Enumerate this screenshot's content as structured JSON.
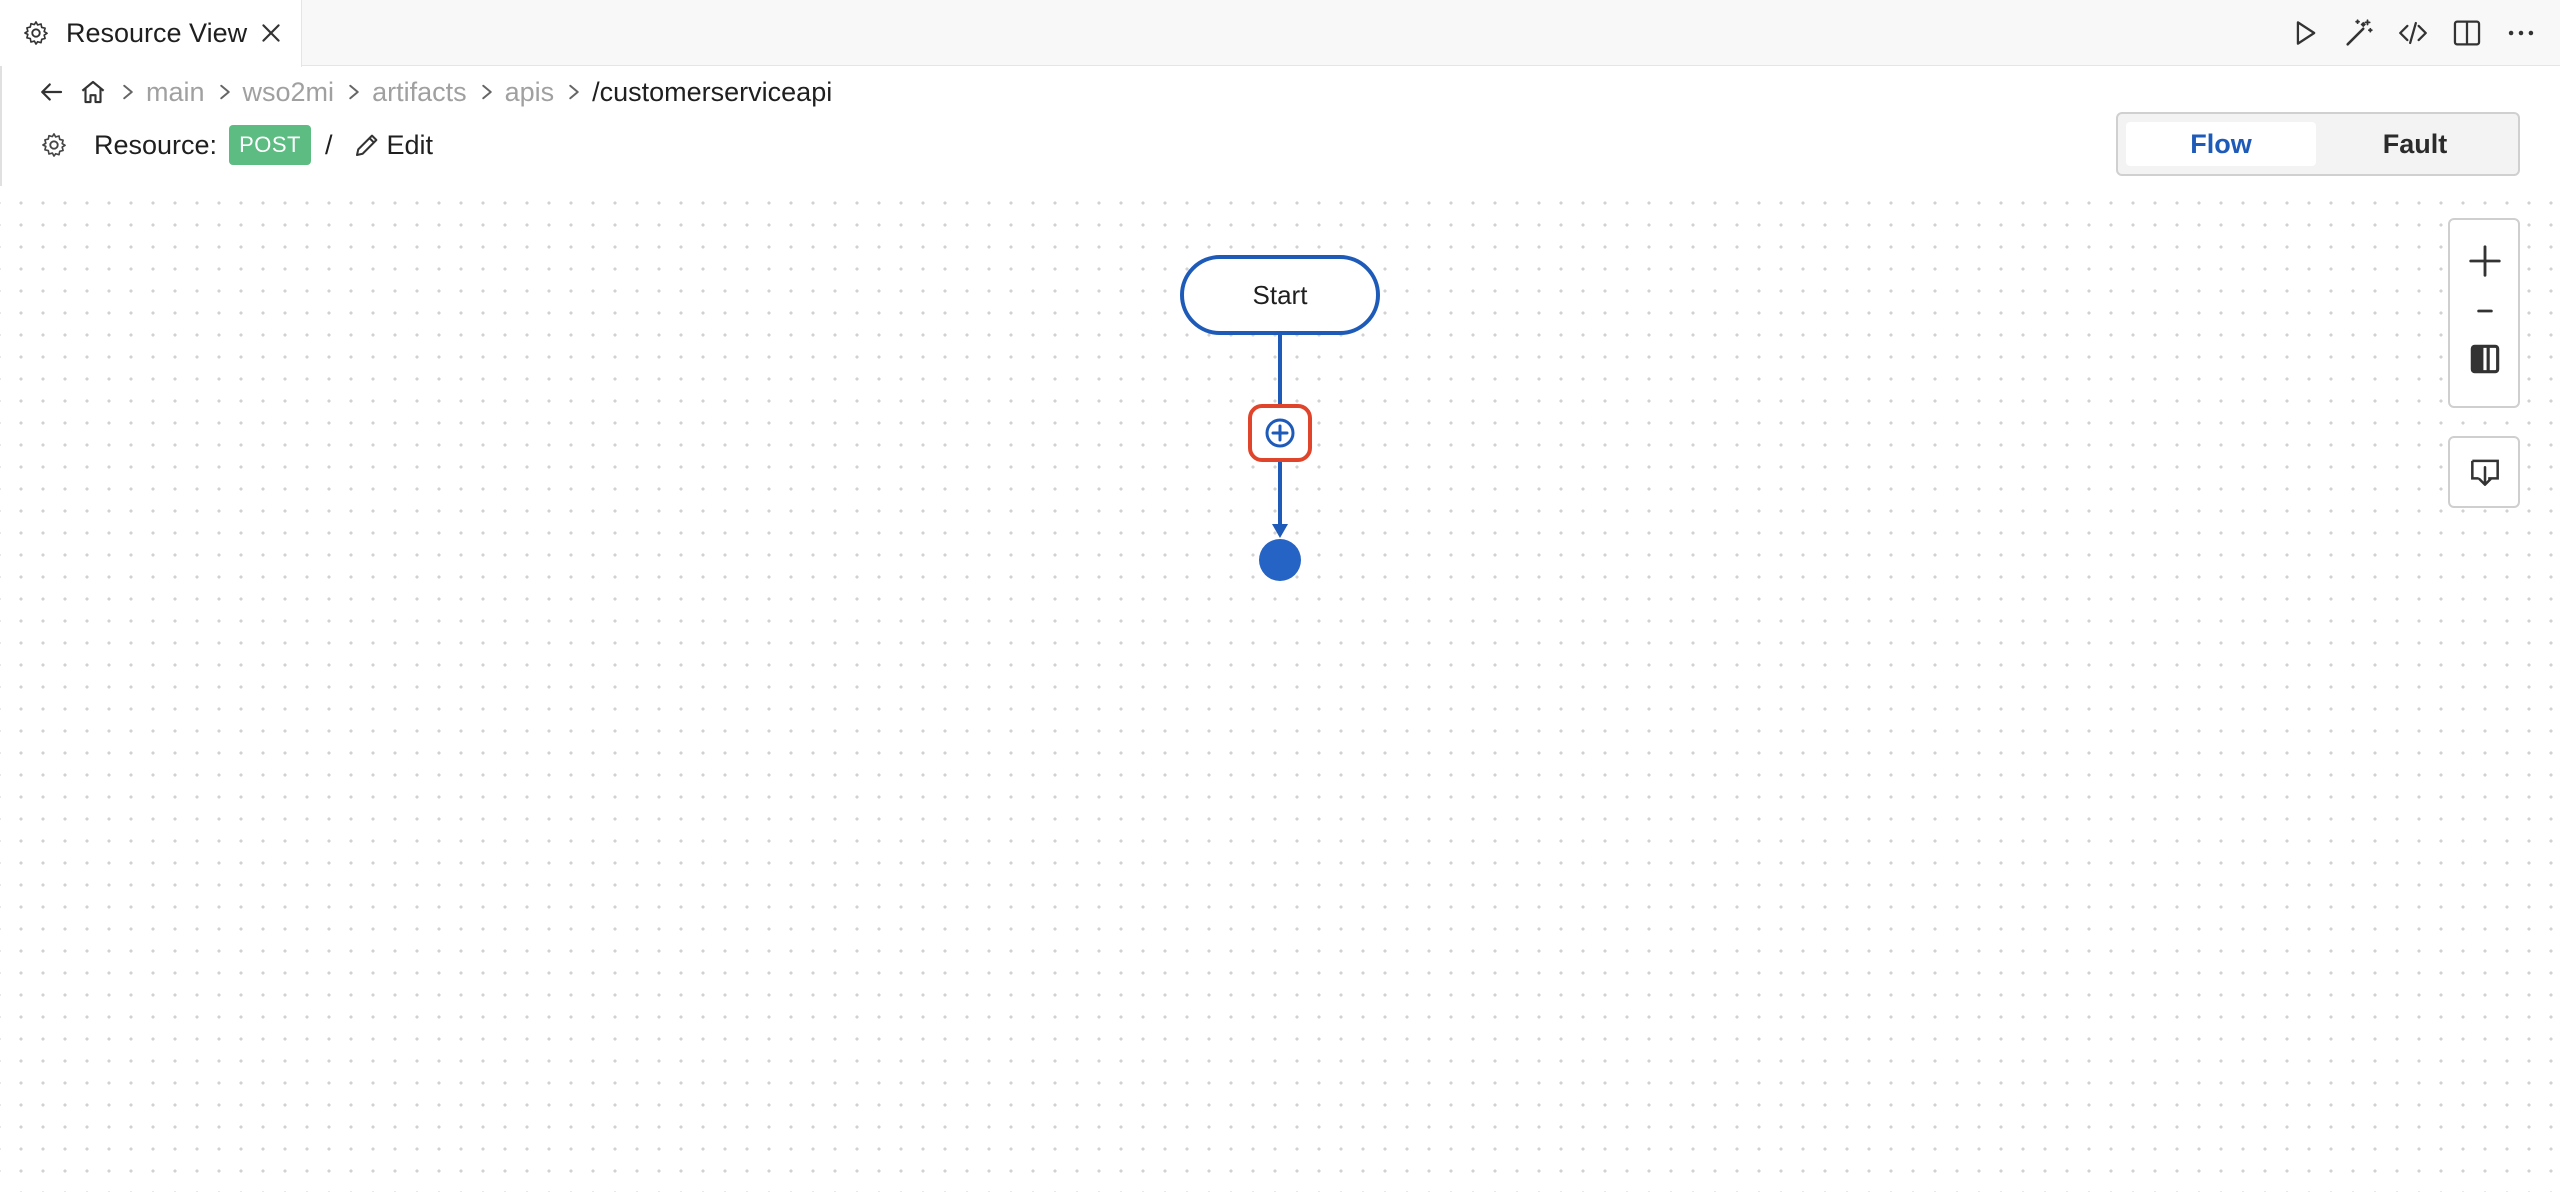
{
  "tab": {
    "title": "Resource View",
    "icon": "gear-icon",
    "close_icon": "close-icon"
  },
  "editor_actions": [
    {
      "name": "run-icon"
    },
    {
      "name": "magic-wand-icon"
    },
    {
      "name": "code-icon"
    },
    {
      "name": "split-editor-icon"
    },
    {
      "name": "more-actions-icon"
    }
  ],
  "breadcrumb": {
    "items": [
      "main",
      "wso2mi",
      "artifacts",
      "apis",
      "/customerserviceapi"
    ]
  },
  "resource": {
    "label": "Resource:",
    "method": "POST",
    "path": "/",
    "edit_label": "Edit",
    "method_color": "#5dbc82"
  },
  "view_toggle": {
    "flow_label": "Flow",
    "fault_label": "Fault",
    "active": "Flow"
  },
  "diagram": {
    "start_label": "Start",
    "accent_color": "#1e5bb8",
    "highlight_color": "#e0442b"
  },
  "zoom": {
    "zoom_in": "+",
    "zoom_out": "−"
  }
}
